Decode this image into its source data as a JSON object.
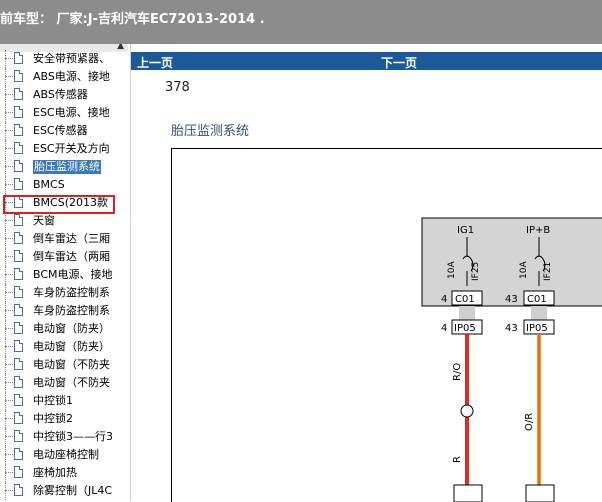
{
  "window": {
    "title": "前车型：   厂家:J-吉利汽车EC72013-2014    ."
  },
  "sidebar": {
    "items": [
      {
        "label": "安全带预紧器、"
      },
      {
        "label": "ABS电源、接地"
      },
      {
        "label": "ABS传感器"
      },
      {
        "label": "ESC电源、接地"
      },
      {
        "label": "ESC传感器"
      },
      {
        "label": "ESC开关及方向"
      },
      {
        "label": "胎压监测系统"
      },
      {
        "label": "BMCS"
      },
      {
        "label": "BMCS(2013款"
      },
      {
        "label": "天窗"
      },
      {
        "label": "倒车雷达（三厢"
      },
      {
        "label": "倒车雷达（两厢"
      },
      {
        "label": "BCM电源、接地"
      },
      {
        "label": "车身防盗控制系"
      },
      {
        "label": "车身防盗控制系"
      },
      {
        "label": "电动窗（防夹）"
      },
      {
        "label": "电动窗（防夹）"
      },
      {
        "label": "电动窗（不防夹"
      },
      {
        "label": "电动窗（不防夹"
      },
      {
        "label": "中控锁1"
      },
      {
        "label": "中控锁2"
      },
      {
        "label": "中控锁3——行3"
      },
      {
        "label": "电动座椅控制"
      },
      {
        "label": "座椅加热"
      },
      {
        "label": "除雾控制（JL4C"
      }
    ],
    "selected_index": 6
  },
  "nav": {
    "prev_label": "上一页",
    "next_label": "下一页"
  },
  "content": {
    "page_number": "378",
    "system_title": "胎压监测系统"
  },
  "diagram": {
    "fuse1": {
      "source": "IG1",
      "rating": "10A",
      "id": "IF25",
      "pin_top": "4",
      "connector_top": "C01",
      "pin_bottom": "4",
      "connector_bottom": "IP05",
      "wire_top": "R/O",
      "wire_bottom": "R"
    },
    "fuse2": {
      "source": "IP+B",
      "rating": "10A",
      "id": "IF21",
      "pin_top": "43",
      "connector_top": "C01",
      "pin_bottom": "43",
      "connector_bottom": "IP05",
      "wire_top": "O/R"
    },
    "colors": {
      "red_wire": "#e8281e",
      "orange_wire": "#f0a020",
      "nav_bg": "#1a5a9a",
      "selected_bg": "#3a78c0",
      "highlight": "#e02020"
    }
  }
}
